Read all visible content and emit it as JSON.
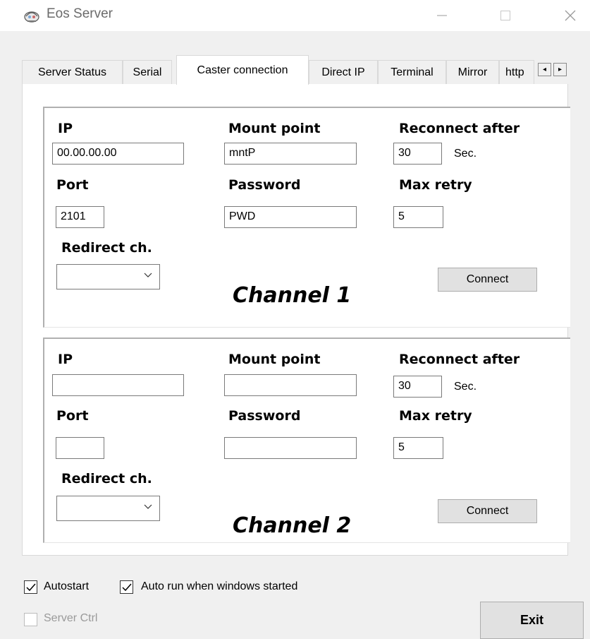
{
  "window": {
    "title": "Eos Server",
    "icon": "eos-app-icon",
    "controls": [
      "minimize-icon",
      "maximize-icon",
      "close-icon"
    ]
  },
  "tabs": [
    {
      "label": "Server Status",
      "active": false
    },
    {
      "label": "Serial",
      "active": false
    },
    {
      "label": "Caster connection",
      "active": true
    },
    {
      "label": "Direct IP",
      "active": false
    },
    {
      "label": "Terminal",
      "active": false
    },
    {
      "label": "Mirror",
      "active": false
    },
    {
      "label": "http",
      "active": false
    }
  ],
  "tab_scroll": {
    "left": "◂",
    "right": "▸"
  },
  "channels": [
    {
      "channel_label": "Channel 1",
      "ip_label": "IP",
      "ip_value": "00.00.00.00",
      "mount_label": "Mount point",
      "mount_value": "mntP",
      "reconnect_label": "Reconnect after",
      "reconnect_value": "30",
      "reconnect_unit": "Sec.",
      "port_label": "Port",
      "port_value": "2101",
      "password_label": "Password",
      "password_value": "PWD",
      "retry_label": "Max retry",
      "retry_value": "5",
      "redirect_label": "Redirect ch.",
      "redirect_value": "",
      "connect_label": "Connect"
    },
    {
      "channel_label": "Channel 2",
      "ip_label": "IP",
      "ip_value": "",
      "mount_label": "Mount point",
      "mount_value": "",
      "reconnect_label": "Reconnect after",
      "reconnect_value": "30",
      "reconnect_unit": "Sec.",
      "port_label": "Port",
      "port_value": "",
      "password_label": "Password",
      "password_value": "",
      "retry_label": "Max retry",
      "retry_value": "5",
      "redirect_label": "Redirect ch.",
      "redirect_value": "",
      "connect_label": "Connect"
    }
  ],
  "options": {
    "autostart": {
      "label": "Autostart",
      "checked": true,
      "enabled": true
    },
    "autorun": {
      "label": "Auto run when windows started",
      "checked": true,
      "enabled": true
    },
    "server_ctrl": {
      "label": "Server Ctrl",
      "checked": false,
      "enabled": false
    }
  },
  "exit_label": "Exit"
}
